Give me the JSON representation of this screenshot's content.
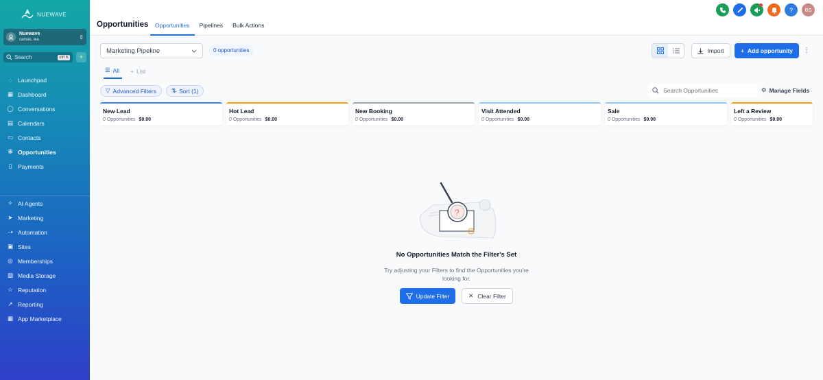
{
  "brand": {
    "name": "NUEWAVE"
  },
  "account": {
    "name": "Nuewave",
    "location": "camas, wa"
  },
  "search": {
    "placeholder": "Search",
    "shortcut": "ctrl K"
  },
  "sidebar": {
    "items": [
      {
        "label": "Launchpad",
        "icon": "rocket-icon"
      },
      {
        "label": "Dashboard",
        "icon": "grid-icon"
      },
      {
        "label": "Conversations",
        "icon": "chat-icon"
      },
      {
        "label": "Calendars",
        "icon": "calendar-icon"
      },
      {
        "label": "Contacts",
        "icon": "contact-icon"
      },
      {
        "label": "Opportunities",
        "icon": "network-icon",
        "active": true
      },
      {
        "label": "Payments",
        "icon": "receipt-icon"
      }
    ],
    "items2": [
      {
        "label": "AI Agents",
        "icon": "sparkle-icon"
      },
      {
        "label": "Marketing",
        "icon": "send-icon"
      },
      {
        "label": "Automation",
        "icon": "flow-icon"
      },
      {
        "label": "Sites",
        "icon": "site-icon"
      },
      {
        "label": "Memberships",
        "icon": "badge-icon"
      },
      {
        "label": "Media Storage",
        "icon": "image-icon"
      },
      {
        "label": "Reputation",
        "icon": "star-icon"
      },
      {
        "label": "Reporting",
        "icon": "trend-icon"
      },
      {
        "label": "App Marketplace",
        "icon": "apps-icon"
      }
    ]
  },
  "header": {
    "title": "Opportunities",
    "tabs": [
      {
        "label": "Opportunities",
        "active": true
      },
      {
        "label": "Pipelines"
      },
      {
        "label": "Bulk Actions"
      }
    ],
    "avatar_initials": "BS"
  },
  "colors": {
    "phone": "#1b9d5a",
    "magic": "#1d6ee8",
    "megaphone": "#1b9d5a",
    "bell": "#f26b1d",
    "help": "#2f7de1",
    "accent": "#1d6ee8"
  },
  "toolbar": {
    "pipeline": "Marketing Pipeline",
    "count": "0 opportunities",
    "import_label": "Import",
    "add_label": "Add opportunity"
  },
  "view_tabs": {
    "all": "All",
    "list": "List"
  },
  "filters": {
    "advanced": "Advanced Filters",
    "sort": "Sort (1)",
    "search_placeholder": "Search Opportunities",
    "manage_fields": "Manage Fields"
  },
  "stages": [
    {
      "name": "New Lead",
      "count": "0 Opportunities",
      "value": "$0.00",
      "color": "#3b82f6"
    },
    {
      "name": "Hot Lead",
      "count": "0 Opportunities",
      "value": "$0.00",
      "color": "#f59e0b"
    },
    {
      "name": "New Booking",
      "count": "0 Opportunities",
      "value": "$0.00",
      "color": "#9ca3af"
    },
    {
      "name": "Visit Attended",
      "count": "0 Opportunities",
      "value": "$0.00",
      "color": "#93c5fd"
    },
    {
      "name": "Sale",
      "count": "0 Opportunities",
      "value": "$0.00",
      "color": "#93c5fd"
    },
    {
      "name": "Left a Review",
      "count": "0 Opportunities",
      "value": "$0.00",
      "color": "#f59e0b"
    }
  ],
  "empty": {
    "title": "No Opportunities Match the Filter's Set",
    "desc_line1": "Try adjusting your Filters to find the Opportunities you're",
    "desc_line2": "looking for.",
    "update_label": "Update Filter",
    "clear_label": "Clear Filter"
  }
}
